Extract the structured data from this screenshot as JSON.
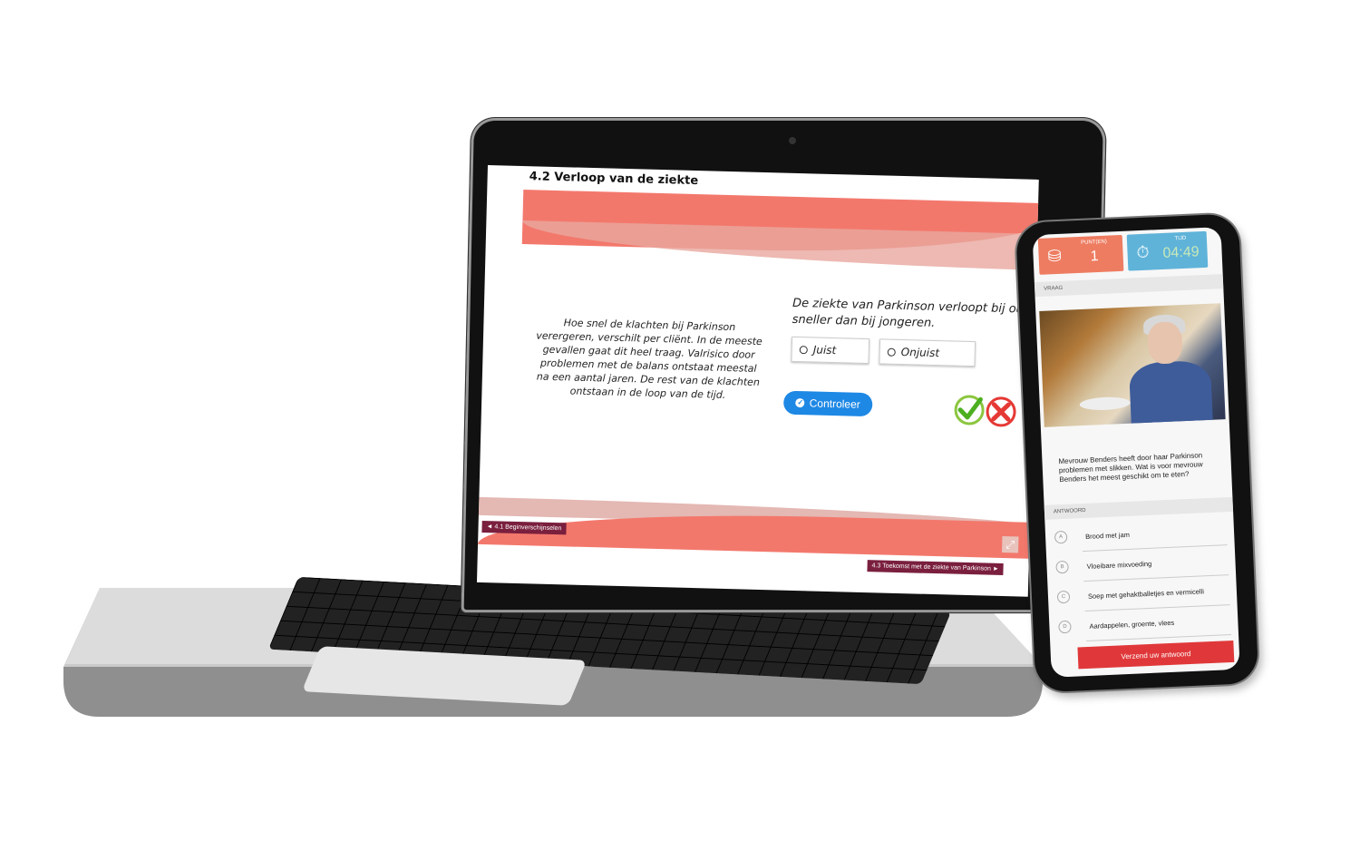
{
  "laptop": {
    "lesson_title": "4.2 Verloop van de ziekte",
    "intro_text": "Hoe snel de klachten bij Parkinson verergeren, verschilt per cliënt. In de meeste gevallen gaat dit heel traag. Valrisico door problemen met de balans ontstaat meestal na een aantal jaren. De rest van de klachten ontstaan in de loop van de tijd.",
    "question_line1": "De ziekte van Parkinson verloopt bij oude",
    "question_line2": "sneller dan bij jongeren.",
    "option_true": "Juist",
    "option_false": "Onjuist",
    "check_button": "Controleer",
    "nav_prev": "◄ 4.1 Beginverschijnselen",
    "nav_next": "4.3 Toekomst met de ziekte van Parkinson ►",
    "icons": {
      "check": "checkmark-icon",
      "cross": "cross-icon",
      "expand": "expand-icon"
    },
    "colors": {
      "band": "#f3786c",
      "button": "#1e88e5",
      "nav": "#7a1f3d"
    }
  },
  "phone": {
    "score_label": "PUNT(EN)",
    "score_value": "1",
    "time_label": "TIJD",
    "time_value": "04:49",
    "question_section": "VRAAG",
    "question": "Mevrouw Benders heeft door haar Parkinson problemen met slikken. Wat is voor mevrouw Benders het meest geschikt om te eten?",
    "answer_section": "ANTWOORD",
    "answers": [
      {
        "letter": "A",
        "text": "Brood met jam"
      },
      {
        "letter": "B",
        "text": "Vloeibare mixvoeding"
      },
      {
        "letter": "C",
        "text": "Soep met gehaktballetjes en vermicelli"
      },
      {
        "letter": "D",
        "text": "Aardappelen, groente, vlees"
      }
    ],
    "submit_button": "Verzend uw antwoord",
    "colors": {
      "score": "#ee7c61",
      "time": "#5fb3d9",
      "submit": "#e0383a"
    }
  }
}
